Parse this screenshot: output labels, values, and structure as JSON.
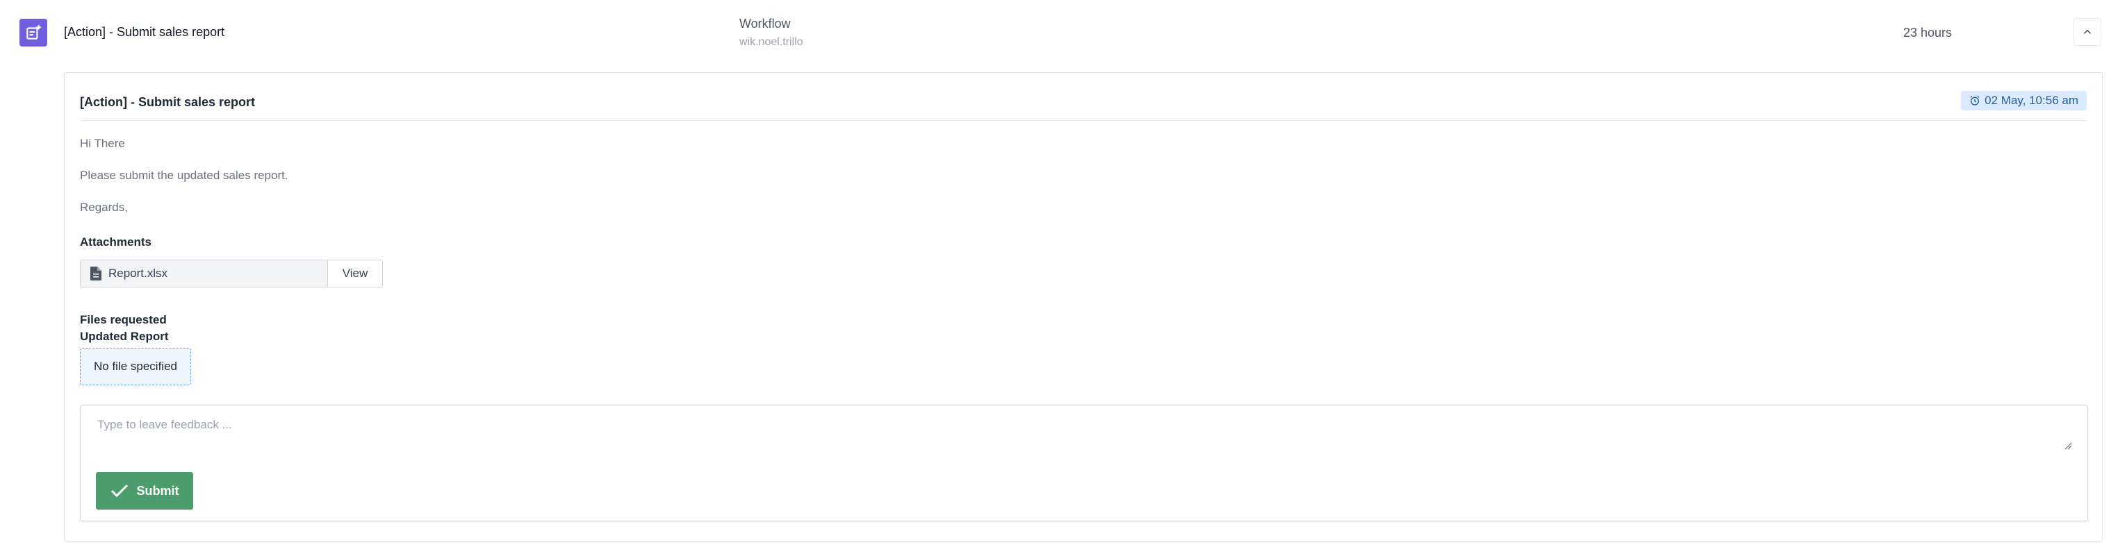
{
  "row": {
    "title": "[Action] - Submit sales report",
    "workflow_label": "Workflow",
    "workflow_user": "wik.noel.trillo",
    "time_ago": "23 hours",
    "type_icon": "task-add-icon",
    "collapse_icon": "chevron-up-icon"
  },
  "card": {
    "title": "[Action] - Submit sales report",
    "date": "02 May, 10:56 am",
    "date_icon": "alarm-clock-icon",
    "message_lines": [
      "Hi There",
      "Please submit the updated sales report.",
      "Regards,"
    ],
    "attachments_label": "Attachments",
    "attachment": {
      "file_name": "Report.xlsx",
      "icon": "document-icon",
      "view_label": "View"
    },
    "files_requested_label": "Files requested",
    "requested_file_name": "Updated Report",
    "file_status": "No file specified",
    "feedback": {
      "placeholder": "Type to leave feedback ...",
      "value": ""
    },
    "submit_label": "Submit",
    "submit_icon": "checkmark-icon"
  },
  "colors": {
    "type_icon_bg": "#6d5fe0",
    "submit_bg": "#4b9e6b",
    "date_badge_bg": "#dbeafe",
    "date_badge_text": "#1e5fa8"
  }
}
